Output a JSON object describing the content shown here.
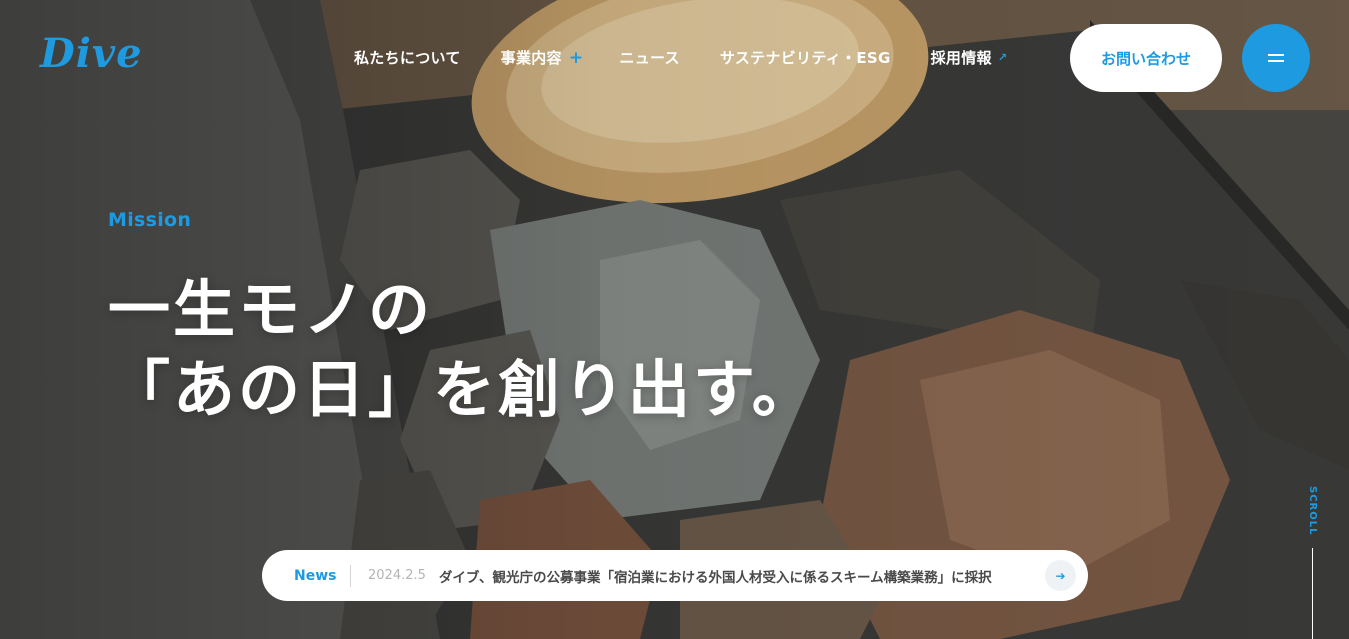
{
  "header": {
    "logo_text": "Dive",
    "nav": {
      "about": "私たちについて",
      "business": "事業内容",
      "news": "ニュース",
      "sustainability": "サステナビリティ・ESG",
      "recruit": "採用情報"
    },
    "contact_label": "お問い合わせ"
  },
  "hero": {
    "eyebrow": "Mission",
    "headline_line1": "一生モノの",
    "headline_line2": "「あの日」を創り出す。"
  },
  "news": {
    "label": "News",
    "date": "2024.2.5",
    "title": "ダイブ、観光庁の公募事業「宿泊業における外国人材受入に係るスキーム構築業務」に採択"
  },
  "scroll": {
    "label": "SCROLL"
  },
  "colors": {
    "accent": "#1e9be0",
    "white": "#ffffff"
  }
}
